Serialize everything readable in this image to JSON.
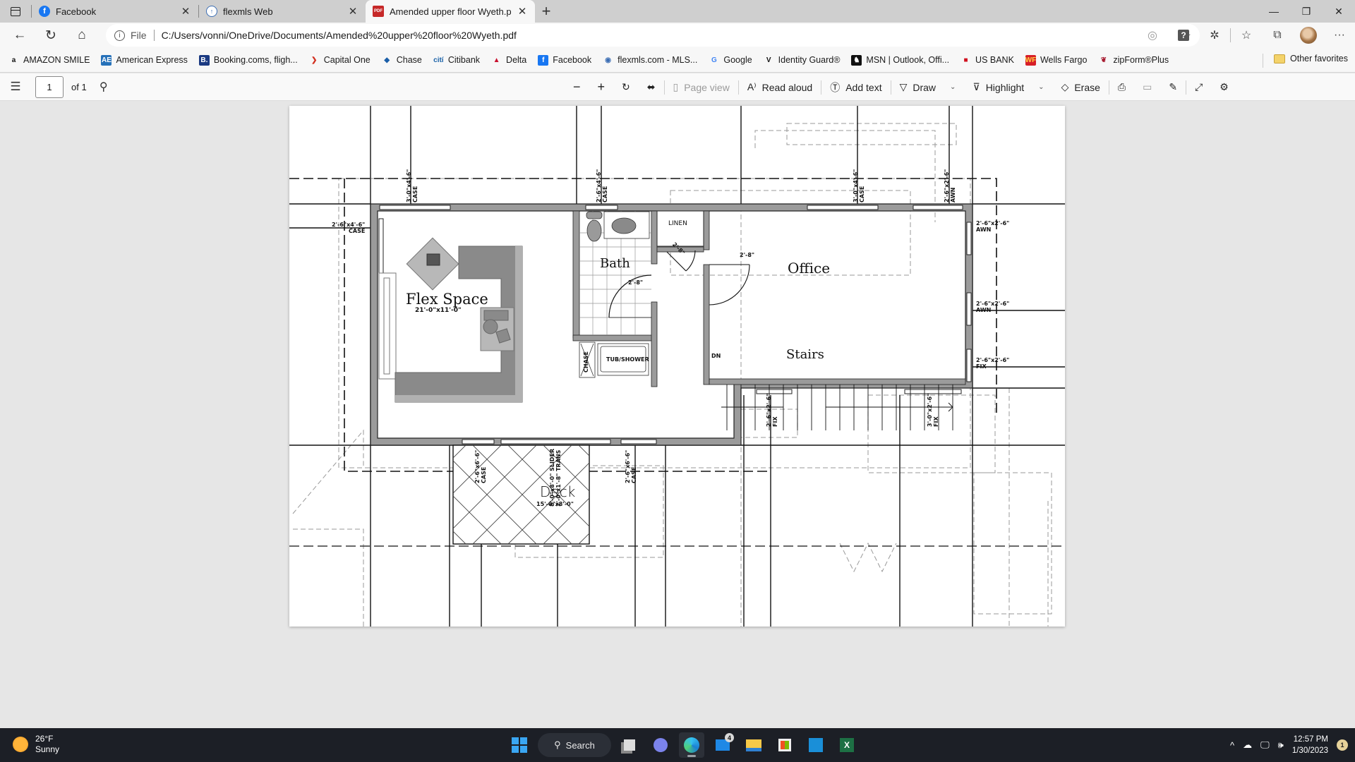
{
  "browser": {
    "tabs": [
      {
        "label": "Facebook",
        "icon": "facebook-icon",
        "active": false
      },
      {
        "label": "flexmls Web",
        "icon": "flexmls-icon",
        "active": false
      },
      {
        "label": "Amended upper floor Wyeth.pdf",
        "icon": "pdf-icon",
        "active": true
      }
    ],
    "address": {
      "scheme_label": "File",
      "url": "C:/Users/vonni/OneDrive/Documents/Amended%20upper%20floor%20Wyeth.pdf"
    },
    "favorites": [
      {
        "label": "AMAZON SMILE",
        "icon": "amazon-icon",
        "glyph": "a",
        "color": "#111111",
        "bg": "transparent"
      },
      {
        "label": "American Express",
        "icon": "amex-icon",
        "glyph": "AE",
        "color": "#ffffff",
        "bg": "#2671b9"
      },
      {
        "label": "Booking.coms, fligh...",
        "icon": "booking-icon",
        "glyph": "B.",
        "color": "#ffffff",
        "bg": "#1b3a82"
      },
      {
        "label": "Capital One",
        "icon": "capital-one-icon",
        "glyph": "❯",
        "color": "#d22e1e",
        "bg": "transparent"
      },
      {
        "label": "Chase",
        "icon": "chase-icon",
        "glyph": "◆",
        "color": "#1a5ea8",
        "bg": "transparent"
      },
      {
        "label": "Citibank",
        "icon": "citibank-icon",
        "glyph": "cití",
        "color": "#1b62a8",
        "bg": "transparent"
      },
      {
        "label": "Delta",
        "icon": "delta-icon",
        "glyph": "▲",
        "color": "#c8102e",
        "bg": "transparent"
      },
      {
        "label": "Facebook",
        "icon": "facebook-icon",
        "glyph": "f",
        "color": "#ffffff",
        "bg": "#1877f2"
      },
      {
        "label": "flexmls.com - MLS...",
        "icon": "flexmls-icon",
        "glyph": "◉",
        "color": "#3c6eb4",
        "bg": "transparent"
      },
      {
        "label": "Google",
        "icon": "google-icon",
        "glyph": "G",
        "color": "#4285f4",
        "bg": "transparent"
      },
      {
        "label": "Identity Guard®",
        "icon": "identity-guard-icon",
        "glyph": "V",
        "color": "#111111",
        "bg": "transparent"
      },
      {
        "label": "MSN | Outlook, Offi...",
        "icon": "msn-icon",
        "glyph": "♞",
        "color": "#ffffff",
        "bg": "#111111"
      },
      {
        "label": "US BANK",
        "icon": "us-bank-icon",
        "glyph": "■",
        "color": "#d0101e",
        "bg": "transparent"
      },
      {
        "label": "Wells Fargo",
        "icon": "wells-fargo-icon",
        "glyph": "WF",
        "color": "#ffcd41",
        "bg": "#d71e28"
      },
      {
        "label": "zipForm®Plus",
        "icon": "zipform-icon",
        "glyph": "❦",
        "color": "#a5152b",
        "bg": "transparent"
      }
    ],
    "other_favorites": "Other favorites"
  },
  "pdf_toolbar": {
    "page_current": "1",
    "page_total": "of 1",
    "page_view": "Page view",
    "read_aloud": "Read aloud",
    "add_text": "Add text",
    "draw": "Draw",
    "highlight": "Highlight",
    "erase": "Erase"
  },
  "floor_plan": {
    "rooms": {
      "flex_space": {
        "name": "Flex Space",
        "size": "21'-0\"x11'-0\""
      },
      "bath": {
        "name": "Bath"
      },
      "office": {
        "name": "Office"
      },
      "stairs": {
        "name": "Stairs",
        "direction": "DN"
      },
      "deck": {
        "name": "Deck",
        "size": "15'-0\"x8'-0\""
      },
      "linen": {
        "name": "LINEN"
      },
      "chase": {
        "name": "CHASE"
      },
      "tub": {
        "name": "TUB/SHOWER"
      }
    },
    "door_dims": [
      "2'-8\"",
      "2'-8\"",
      "2'-8\""
    ],
    "windows": [
      {
        "size": "3'-0\"x4'-6\"",
        "type": "CASE"
      },
      {
        "size": "2'-6\"x4'-6\"",
        "type": "CASE"
      },
      {
        "size": "3'-0\"x4'-6\"",
        "type": "CASE"
      },
      {
        "size": "2'-6\"x2'-6\"",
        "type": "AWN"
      },
      {
        "size": "2'-6\"x4'-6\"",
        "type": "CASE"
      },
      {
        "size": "2'-6\"x2'-6\"",
        "type": "AWN"
      },
      {
        "size": "2'-6\"x2'-6\"",
        "type": "AWN"
      },
      {
        "size": "2'-6\"x2'-6\"",
        "type": "FIX"
      },
      {
        "size": "2'-6\"x2'-6\"",
        "type": "FIX"
      },
      {
        "size": "3'-0\"x2'-6\"",
        "type": "FIX"
      },
      {
        "size": "2'-6\"x6'-6\"",
        "type": "CASE"
      },
      {
        "size": "8'-0\"x8'-0\" SLIDER",
        "type": "2'-0\"x1'-8\" TRANS"
      },
      {
        "size": "2'-6\"x6'-6\"",
        "type": "CASE"
      }
    ]
  },
  "taskbar": {
    "weather_temp": "26°F",
    "weather_desc": "Sunny",
    "search_label": "Search",
    "mail_badge": "4",
    "time": "12:57 PM",
    "date": "1/30/2023",
    "notifications": "1"
  }
}
